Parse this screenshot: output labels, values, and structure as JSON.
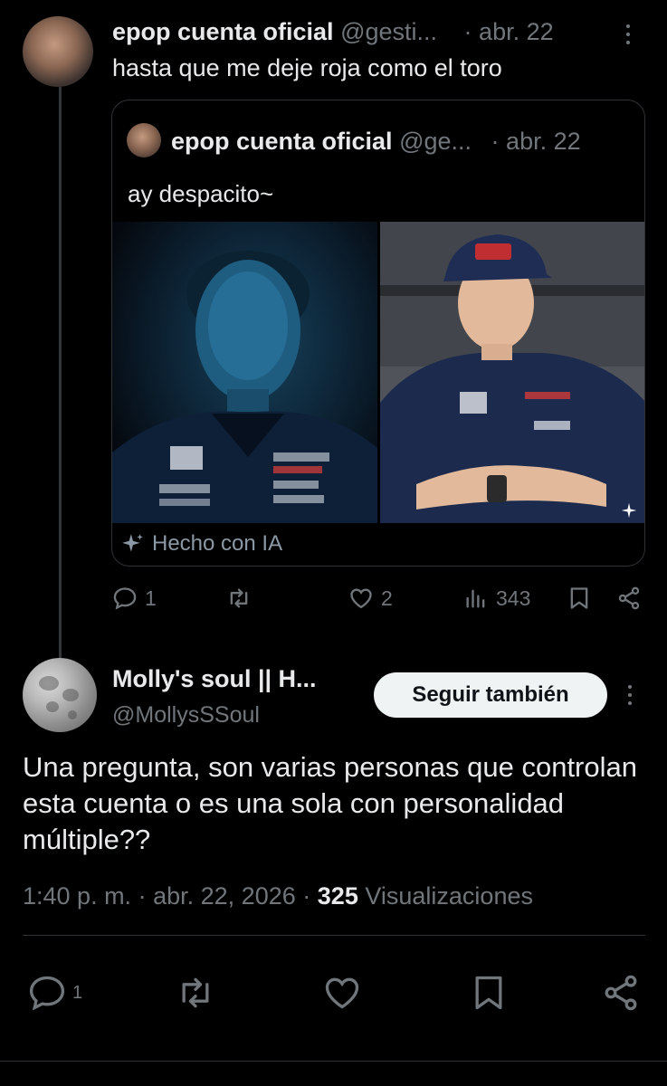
{
  "reply": {
    "name": "epop cuenta oficial",
    "handle": "@gesti...",
    "sep": "·",
    "date": "abr. 22",
    "text": "hasta que me deje roja como el toro"
  },
  "quote": {
    "name": "epop cuenta oficial",
    "handle": "@ge...",
    "sep": "·",
    "date": "abr. 22",
    "text": "ay despacito~",
    "ai_label": "Hecho con IA"
  },
  "reply_actions": {
    "replies": "1",
    "likes": "2",
    "views": "343"
  },
  "post": {
    "name": "Molly's soul || H...",
    "handle": "@MollysSSoul",
    "follow_label": "Seguir también",
    "text": "Una pregunta, son varias personas que controlan esta cuenta o es una sola con personalidad múltiple??",
    "time": "1:40 p. m.",
    "sep1": "·",
    "date": "abr. 22, 2026",
    "sep2": "·",
    "views_count": "325",
    "views_label": "Visualizaciones",
    "reply_count": "1"
  },
  "colors": {
    "background": "#000000",
    "text": "#e7e9ea",
    "muted": "#71767b",
    "border": "#2f3336",
    "button_bg": "#eff3f4"
  }
}
